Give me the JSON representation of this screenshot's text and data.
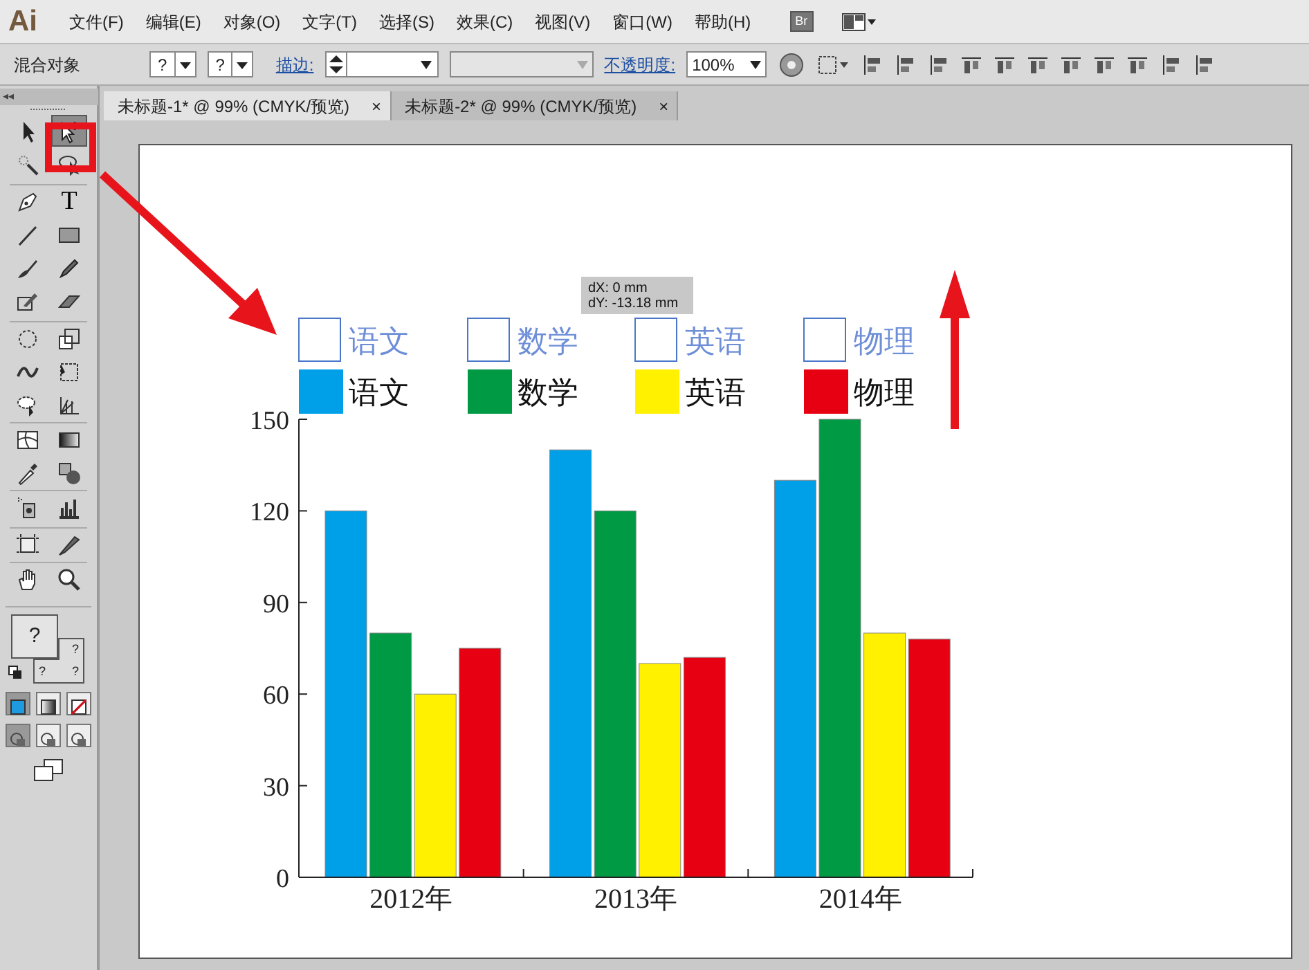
{
  "app": {
    "logo": "Ai",
    "menu": [
      "文件(F)",
      "编辑(E)",
      "对象(O)",
      "文字(T)",
      "选择(S)",
      "效果(C)",
      "视图(V)",
      "窗口(W)",
      "帮助(H)"
    ],
    "bridge_button": "Br"
  },
  "control_bar": {
    "selection_label": "混合对象",
    "dropdowns": [
      "?",
      "?"
    ],
    "stroke_label": "描边:",
    "opacity_label": "不透明度:",
    "opacity_value": "100%"
  },
  "tabs": [
    {
      "label": "未标题-1* @ 99% (CMYK/预览)",
      "close": "×",
      "selected": true
    },
    {
      "label": "未标题-2* @ 99% (CMYK/预览)",
      "close": "×",
      "selected": false
    }
  ],
  "tools": [
    {
      "kind": "arrow",
      "selected": false
    },
    {
      "kind": "direct",
      "selected": true
    },
    {
      "kind": "wand",
      "selected": false
    },
    {
      "kind": "lasso",
      "selected": false
    },
    {
      "kind": "pen",
      "selected": false
    },
    {
      "kind": "type",
      "glyph": "T",
      "selected": false
    },
    {
      "kind": "line",
      "selected": false
    },
    {
      "kind": "rect",
      "selected": false
    },
    {
      "kind": "brush",
      "selected": false
    },
    {
      "kind": "pencil",
      "selected": false
    },
    {
      "kind": "blob",
      "selected": false
    },
    {
      "kind": "eraser",
      "selected": false
    },
    {
      "kind": "rotate",
      "selected": false
    },
    {
      "kind": "scale",
      "selected": false
    },
    {
      "kind": "warp",
      "selected": false
    },
    {
      "kind": "transform",
      "selected": false
    },
    {
      "kind": "builder",
      "selected": false
    },
    {
      "kind": "perspective",
      "selected": false
    },
    {
      "kind": "mesh",
      "selected": false
    },
    {
      "kind": "gradient",
      "selected": false
    },
    {
      "kind": "dropper",
      "selected": false
    },
    {
      "kind": "blend",
      "selected": false
    },
    {
      "kind": "sprayer",
      "selected": false
    },
    {
      "kind": "graph",
      "selected": false
    },
    {
      "kind": "artboard",
      "selected": false
    },
    {
      "kind": "slice",
      "selected": false
    },
    {
      "kind": "hand",
      "selected": false
    },
    {
      "kind": "zoom",
      "selected": false
    }
  ],
  "panel_header": "◂◂",
  "fill_stroke": {
    "fill_label": "?",
    "stroke_labels": [
      "?",
      "?",
      "?"
    ]
  },
  "color_modes": [
    {
      "kind": "color",
      "selected": true
    },
    {
      "kind": "gradient",
      "selected": false
    },
    {
      "kind": "none",
      "selected": false
    }
  ],
  "draw_modes": [
    {
      "selected": true
    },
    {
      "selected": false
    },
    {
      "selected": false
    }
  ],
  "artboard": {
    "drag_preview_legend": [
      "语文",
      "数学",
      "英语",
      "物理"
    ],
    "tooltip": [
      "dX: 0 mm",
      "dY: -13.18 mm"
    ],
    "chart_data": {
      "type": "bar",
      "categories": [
        "2012年",
        "2013年",
        "2014年"
      ],
      "series": [
        {
          "name": "语文",
          "color": "#00a0e9",
          "values": [
            120,
            140,
            130
          ]
        },
        {
          "name": "数学",
          "color": "#009944",
          "values": [
            80,
            120,
            150
          ]
        },
        {
          "name": "英语",
          "color": "#fff100",
          "values": [
            60,
            70,
            80
          ]
        },
        {
          "name": "物理",
          "color": "#e60012",
          "values": [
            75,
            72,
            78
          ]
        }
      ],
      "legend": true,
      "ylim": [
        0,
        150
      ],
      "yticks": [
        0,
        30,
        60,
        90,
        120,
        150
      ]
    }
  }
}
